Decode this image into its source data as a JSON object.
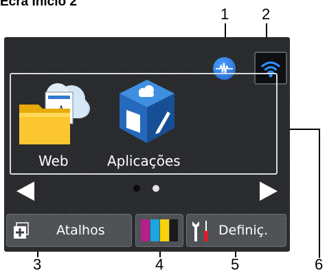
{
  "heading": "Ecrã Início 2",
  "callouts": [
    "1",
    "2",
    "3",
    "4",
    "5",
    "6"
  ],
  "apps": [
    {
      "label": "Web",
      "icon": "web-folder-icon"
    },
    {
      "label": "Aplicações",
      "icon": "apps-cube-icon"
    }
  ],
  "status_icons": [
    "wired-lan-icon",
    "wifi-icon"
  ],
  "pagination": {
    "pages": 2,
    "current": 2
  },
  "buttons": [
    {
      "label": "Atalhos",
      "icon": "shortcut-plus-icon"
    },
    {
      "label": "",
      "icon": "ink-cartridges-icon"
    },
    {
      "label": "Definiç.",
      "icon": "tools-icon"
    }
  ],
  "colors": {
    "screen_bg": "#2e3032",
    "panel_border": "#d9dadc",
    "wifi_blue": "#2e8fff",
    "ink_magenta": "#b61e8b",
    "ink_cyan": "#1aa6df",
    "ink_yellow": "#f7d30c",
    "ink_black": "#1a1a1a"
  }
}
